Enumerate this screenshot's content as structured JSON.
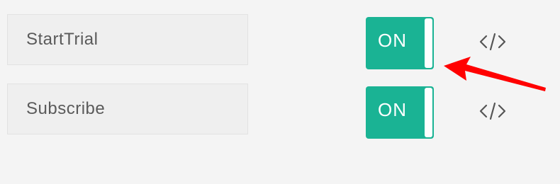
{
  "events": [
    {
      "name": "StartTrial",
      "toggle_label": "ON",
      "toggle_on": true,
      "code_icon": "code-icon"
    },
    {
      "name": "Subscribe",
      "toggle_label": "ON",
      "toggle_on": true,
      "code_icon": "code-icon"
    }
  ],
  "colors": {
    "toggle_on": "#1ab394",
    "annotation_arrow": "#ff0000",
    "background": "#f4f4f4"
  },
  "annotation": {
    "icon": "arrow-pointer",
    "color": "#ff0000"
  }
}
